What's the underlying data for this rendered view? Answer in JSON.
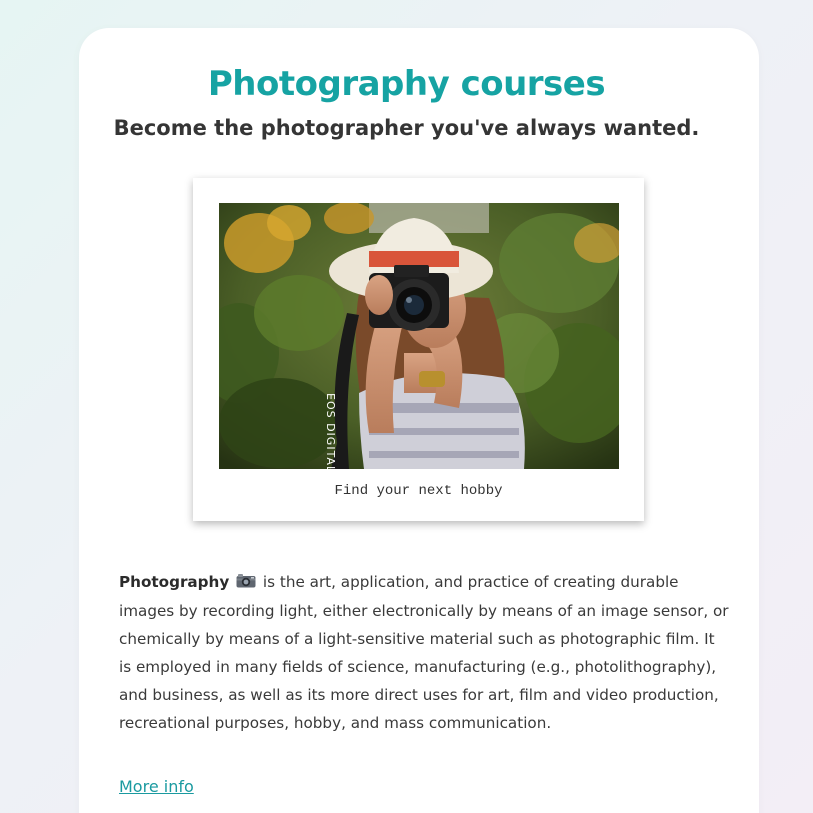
{
  "header": {
    "title": "Photography courses",
    "subtitle": "Become the photographer you've always wanted."
  },
  "figure": {
    "caption": "Find your next hobby"
  },
  "article": {
    "term": "Photography",
    "emoji_icon": "camera-icon",
    "body": "is the art, application, and practice of creating durable images by recording light, either electronically by means of an image sensor, or chemically by means of a light-sensitive material such as photographic film. It is employed in many fields of science, manufacturing (e.g., photolithography), and business, as well as its more direct uses for art, film and video production, recreational purposes, hobby, and mass communication."
  },
  "link": {
    "label": "More info"
  },
  "colors": {
    "accent": "#16a3a3",
    "link": "#1a9aa0",
    "text": "#3a3a3a"
  }
}
